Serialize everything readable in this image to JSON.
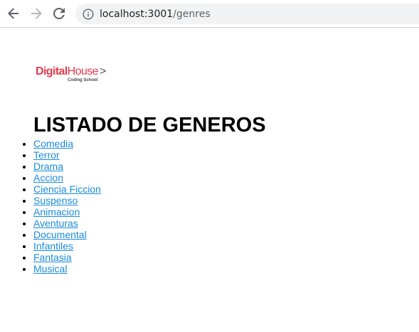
{
  "browser": {
    "url_host": "localhost:3001",
    "url_path": "/genres",
    "icons": {
      "back": "arrow-left-icon",
      "forward": "arrow-right-icon",
      "reload": "reload-icon",
      "info": "info-icon"
    }
  },
  "logo": {
    "name_part1": "Digital",
    "name_part2": "House",
    "chevron": ">",
    "tagline": "Coding School",
    "brand_color": "#e33b4a"
  },
  "page": {
    "title": "LISTADO DE GENEROS",
    "link_color": "#1a8cd8"
  },
  "genres": [
    "Comedia",
    "Terror",
    "Drama",
    "Accion",
    "Ciencia Ficcion",
    "Suspenso",
    "Animacion",
    "Aventuras",
    "Documental",
    "Infantiles",
    "Fantasia",
    "Musical"
  ]
}
